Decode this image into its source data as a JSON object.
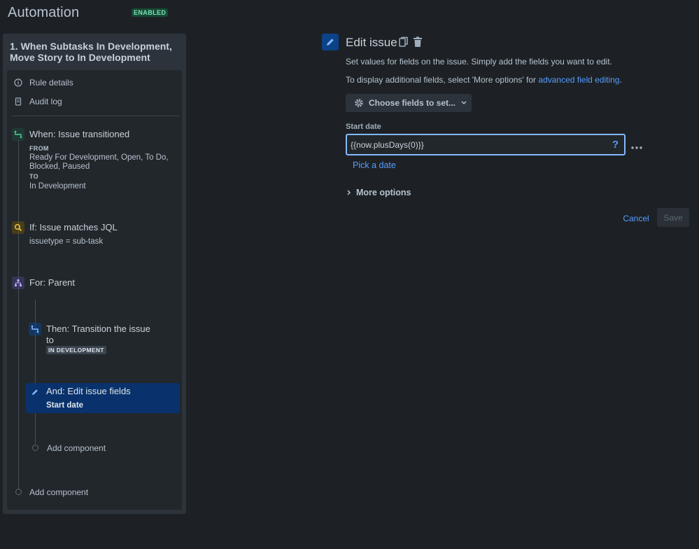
{
  "header": {
    "title": "Automation",
    "status_badge": "ENABLED"
  },
  "rule": {
    "title": "1. When Subtasks In Development, Move Story to In Development",
    "menu": [
      {
        "label": "Rule details",
        "icon": "info-icon"
      },
      {
        "label": "Audit log",
        "icon": "document-icon"
      }
    ],
    "trigger": {
      "title": "When: Issue transitioned",
      "from_label": "FROM",
      "from_value": "Ready For Development, Open, To Do, Blocked, Paused",
      "to_label": "TO",
      "to_value": "In Development",
      "icon": "transition-icon",
      "icon_color": "#1f845a"
    },
    "condition": {
      "title": "If: Issue matches JQL",
      "detail": "issuetype = sub-task",
      "icon": "search-icon",
      "icon_color": "#7f5f01"
    },
    "branch": {
      "title": "For: Parent",
      "icon": "hierarchy-icon",
      "icon_color": "#5e4db2"
    },
    "action_transition": {
      "title": "Then: Transition the issue to",
      "status": "IN DEVELOPMENT",
      "icon": "transition-icon"
    },
    "action_edit": {
      "title": "And: Edit issue fields",
      "detail": "Start date",
      "icon": "pencil-icon"
    },
    "add_component_inner": "Add component",
    "add_component_outer": "Add component"
  },
  "editor": {
    "title": "Edit issue",
    "description_1": "Set values for fields on the issue. Simply add the fields you want to edit.",
    "description_2_prefix": "To display additional fields, select 'More options' for ",
    "description_2_link": "advanced field editing",
    "description_2_suffix": ".",
    "choose_fields_label": "Choose fields to set...",
    "field_label": "Start date",
    "field_value": "{{now.plusDays(0)}}",
    "help_symbol": "?",
    "pick_date_label": "Pick a date",
    "more_options_label": "More options",
    "cancel_label": "Cancel",
    "save_label": "Save",
    "accent_color": "#579dff"
  }
}
